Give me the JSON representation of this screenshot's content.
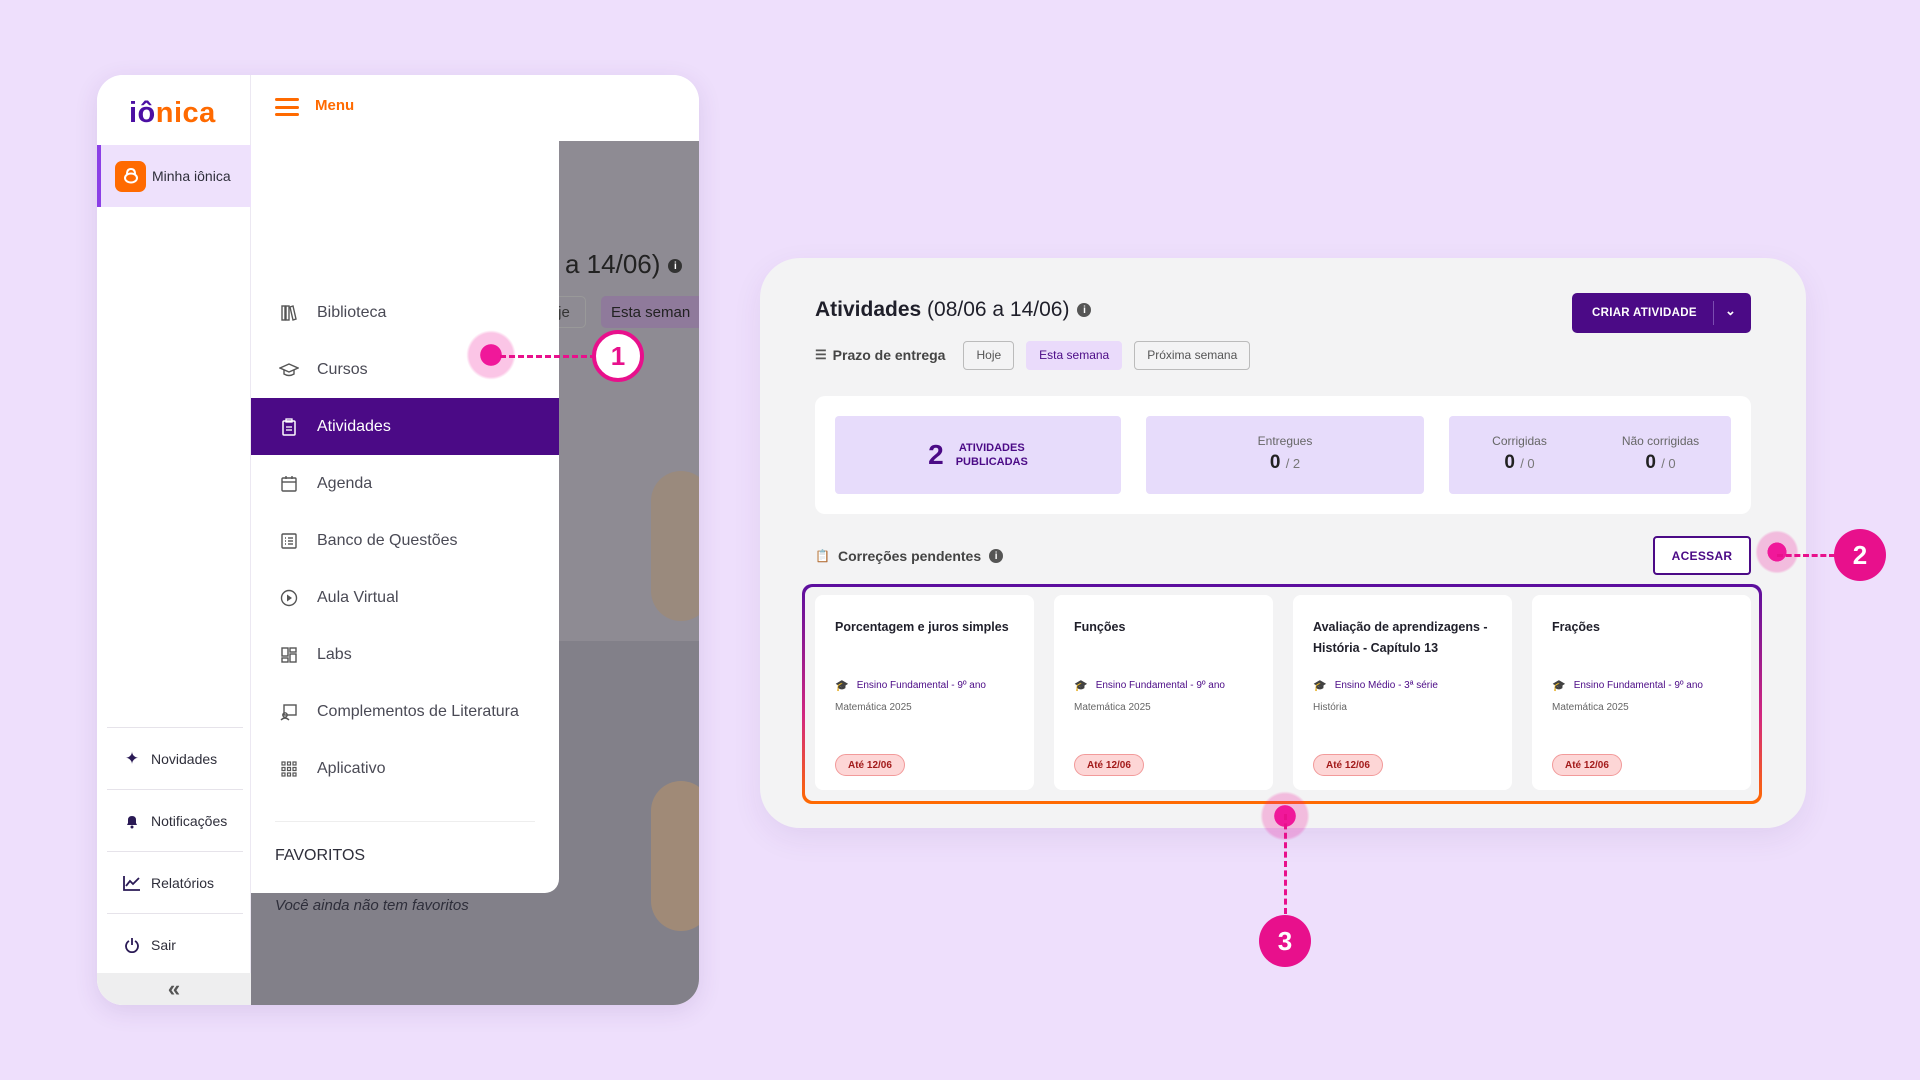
{
  "app": {
    "logo_part1": "iô",
    "logo_part2": "nica",
    "rail": {
      "active_label": "Minha iônica",
      "items": [
        {
          "label": "Novidades"
        },
        {
          "label": "Notificações"
        },
        {
          "label": "Relatórios"
        },
        {
          "label": "Sair"
        }
      ],
      "collapse_glyph": "«"
    },
    "menu_label": "Menu",
    "background_page": {
      "title_fragment": "a 14/06)",
      "chip_fragment_1": "je",
      "chip_fragment_2": "Esta seman"
    },
    "drawer": {
      "items": [
        {
          "label": "Biblioteca",
          "icon": "books-icon"
        },
        {
          "label": "Cursos",
          "icon": "graduation-cap-icon"
        },
        {
          "label": "Atividades",
          "icon": "clipboard-icon",
          "active": true
        },
        {
          "label": "Agenda",
          "icon": "calendar-icon"
        },
        {
          "label": "Banco de Questões",
          "icon": "list-icon"
        },
        {
          "label": "Aula Virtual",
          "icon": "play-icon"
        },
        {
          "label": "Labs",
          "icon": "labs-icon"
        },
        {
          "label": "Complementos de Literatura",
          "icon": "reader-icon"
        },
        {
          "label": "Aplicativo",
          "icon": "grid-icon"
        }
      ],
      "favorites_title": "FAVORITOS",
      "favorites_empty": "Você ainda não tem favoritos"
    }
  },
  "callouts": [
    "1",
    "2",
    "3"
  ],
  "panel": {
    "title_bold": "Atividades",
    "title_rest": " (08/06 a 14/06)",
    "create_button": "CRIAR ATIVIDADE",
    "filter_label": "Prazo de entrega",
    "filters": [
      {
        "label": "Hoje",
        "selected": false
      },
      {
        "label": "Esta semana",
        "selected": true
      },
      {
        "label": "Próxima semana",
        "selected": false
      }
    ],
    "stats": {
      "published_count": "2",
      "published_label_1": "ATIVIDADES",
      "published_label_2": "PUBLICADAS",
      "delivered_label": "Entregues",
      "delivered_value": "0",
      "delivered_total": "/ 2",
      "corrected_label": "Corrigidas",
      "corrected_value": "0",
      "corrected_total": "/ 0",
      "uncorrected_label": "Não corrigidas",
      "uncorrected_value": "0",
      "uncorrected_total": "/ 0"
    },
    "pending_label": "Correções pendentes",
    "access_button": "ACESSAR",
    "cards": [
      {
        "title": "Porcentagem e juros simples",
        "level": "Ensino Fundamental - 9º ano",
        "subject": "Matemática 2025",
        "due": "Até 12/06"
      },
      {
        "title": "Funções",
        "level": "Ensino Fundamental - 9º ano",
        "subject": "Matemática 2025",
        "due": "Até 12/06"
      },
      {
        "title": "Avaliação de aprendizagens - História - Capítulo 13",
        "level": "Ensino Médio - 3ª série",
        "subject": "História",
        "due": "Até 12/06"
      },
      {
        "title": "Frações",
        "level": "Ensino Fundamental - 9º ano",
        "subject": "Matemática 2025",
        "due": "Até 12/06"
      }
    ]
  },
  "colors": {
    "brand_purple": "#4b0a86",
    "brand_orange": "#ff6a00",
    "callout_pink": "#e8108c",
    "background": "#eedffc"
  }
}
